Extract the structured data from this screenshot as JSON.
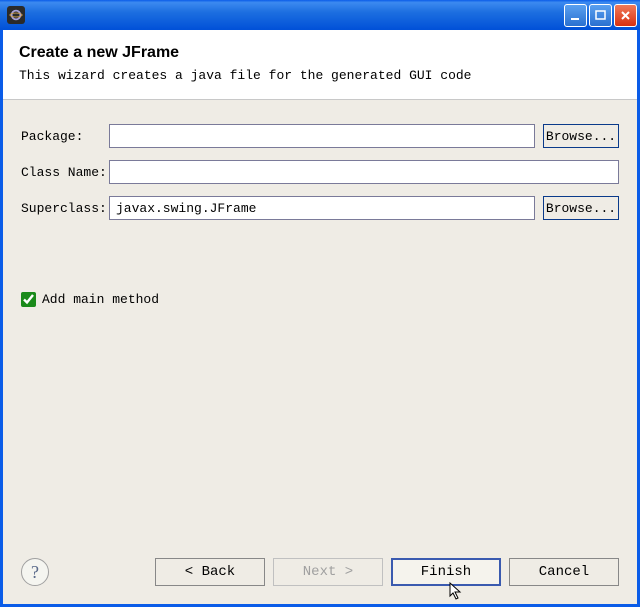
{
  "header": {
    "title": "Create a new JFrame",
    "description": "This wizard creates a java file for the generated GUI code"
  },
  "form": {
    "package_label": "Package:",
    "package_value": "",
    "classname_label": "Class Name:",
    "classname_value": "",
    "superclass_label": "Superclass:",
    "superclass_value": "javax.swing.JFrame",
    "browse_label": "Browse...",
    "checkbox_label": "Add main method"
  },
  "buttons": {
    "help": "?",
    "back": "< Back",
    "next": "Next >",
    "finish": "Finish",
    "cancel": "Cancel"
  }
}
